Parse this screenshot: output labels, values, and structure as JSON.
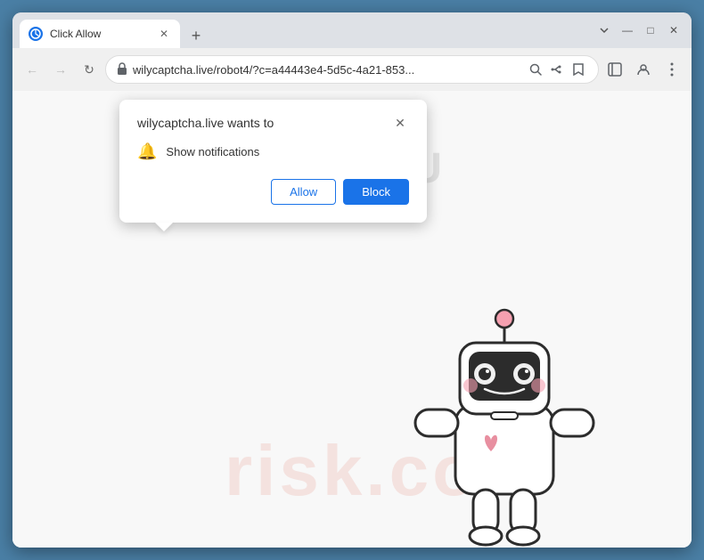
{
  "browser": {
    "tab": {
      "title": "Click Allow",
      "favicon": "©"
    },
    "controls": {
      "minimize": "—",
      "maximize": "□",
      "close": "✕",
      "chevron_down": "⌄",
      "new_tab": "+",
      "tab_close": "✕"
    },
    "address": {
      "url": "wilycaptcha.live/robot4/?c=a44443e4-5d5c-4a21-853...",
      "lock_icon": "🔒"
    },
    "nav": {
      "back": "←",
      "forward": "→",
      "refresh": "↻"
    },
    "toolbar_icons": {
      "search": "🔍",
      "share": "⎋",
      "bookmark": "☆",
      "sidebar": "▣",
      "profile": "⊙",
      "menu": "⋮"
    }
  },
  "popup": {
    "title": "wilycaptcha.live wants to",
    "close_label": "✕",
    "permission_text": "Show notifications",
    "bell_icon": "🔔",
    "allow_label": "Allow",
    "block_label": "Block"
  },
  "webpage": {
    "watermark": "risk.co",
    "bubble_text": "OU"
  }
}
